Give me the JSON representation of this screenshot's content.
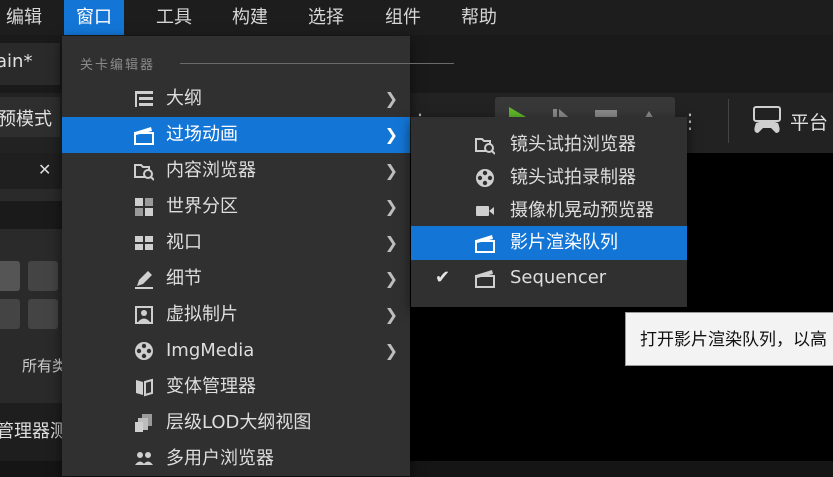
{
  "menubar": {
    "items": [
      "编辑",
      "窗口",
      "工具",
      "构建",
      "选择",
      "组件",
      "帮助"
    ],
    "active_index": 1
  },
  "background": {
    "tab_title_fragment": "ain*",
    "mode_label_fragment": "预模式",
    "platform_label": "平台",
    "close_glyph": "✕",
    "all_label_fragment": "所有类",
    "bottom_label_fragment": "管理器测"
  },
  "window_menu": {
    "section_title": "关卡编辑器",
    "items": [
      {
        "label": "大纲",
        "icon": "outliner-icon",
        "submenu": true
      },
      {
        "label": "过场动画",
        "icon": "clapperboard-icon",
        "submenu": true,
        "highlighted": true
      },
      {
        "label": "内容浏览器",
        "icon": "folder-search-icon",
        "submenu": true
      },
      {
        "label": "世界分区",
        "icon": "world-partition-icon",
        "submenu": true
      },
      {
        "label": "视口",
        "icon": "viewport-icon",
        "submenu": true
      },
      {
        "label": "细节",
        "icon": "details-icon",
        "submenu": true
      },
      {
        "label": "虚拟制片",
        "icon": "virtual-production-icon",
        "submenu": true
      },
      {
        "label": "ImgMedia",
        "icon": "film-reel-icon",
        "submenu": true
      },
      {
        "label": "变体管理器",
        "icon": "variant-manager-icon",
        "submenu": false
      },
      {
        "label": "层级LOD大纲视图",
        "icon": "hlod-icon",
        "submenu": false
      },
      {
        "label": "多用户浏览器",
        "icon": "multi-user-icon",
        "submenu": false
      }
    ]
  },
  "cinematics_submenu": {
    "items": [
      {
        "label": "镜头试拍浏览器",
        "icon": "take-browser-icon",
        "checked": false
      },
      {
        "label": "镜头试拍录制器",
        "icon": "take-recorder-icon",
        "checked": false
      },
      {
        "label": "摄像机晃动预览器",
        "icon": "camera-shake-icon",
        "checked": false
      },
      {
        "label": "影片渲染队列",
        "icon": "movie-render-queue-icon",
        "checked": false,
        "highlighted": true
      },
      {
        "label": "Sequencer",
        "icon": "sequencer-icon",
        "checked": true
      }
    ]
  },
  "tooltip": {
    "text": "打开影片渲染队列，以高"
  },
  "colors": {
    "highlight": "#1376d6",
    "menu_bg": "#303030",
    "play_green": "#5fb82a"
  }
}
